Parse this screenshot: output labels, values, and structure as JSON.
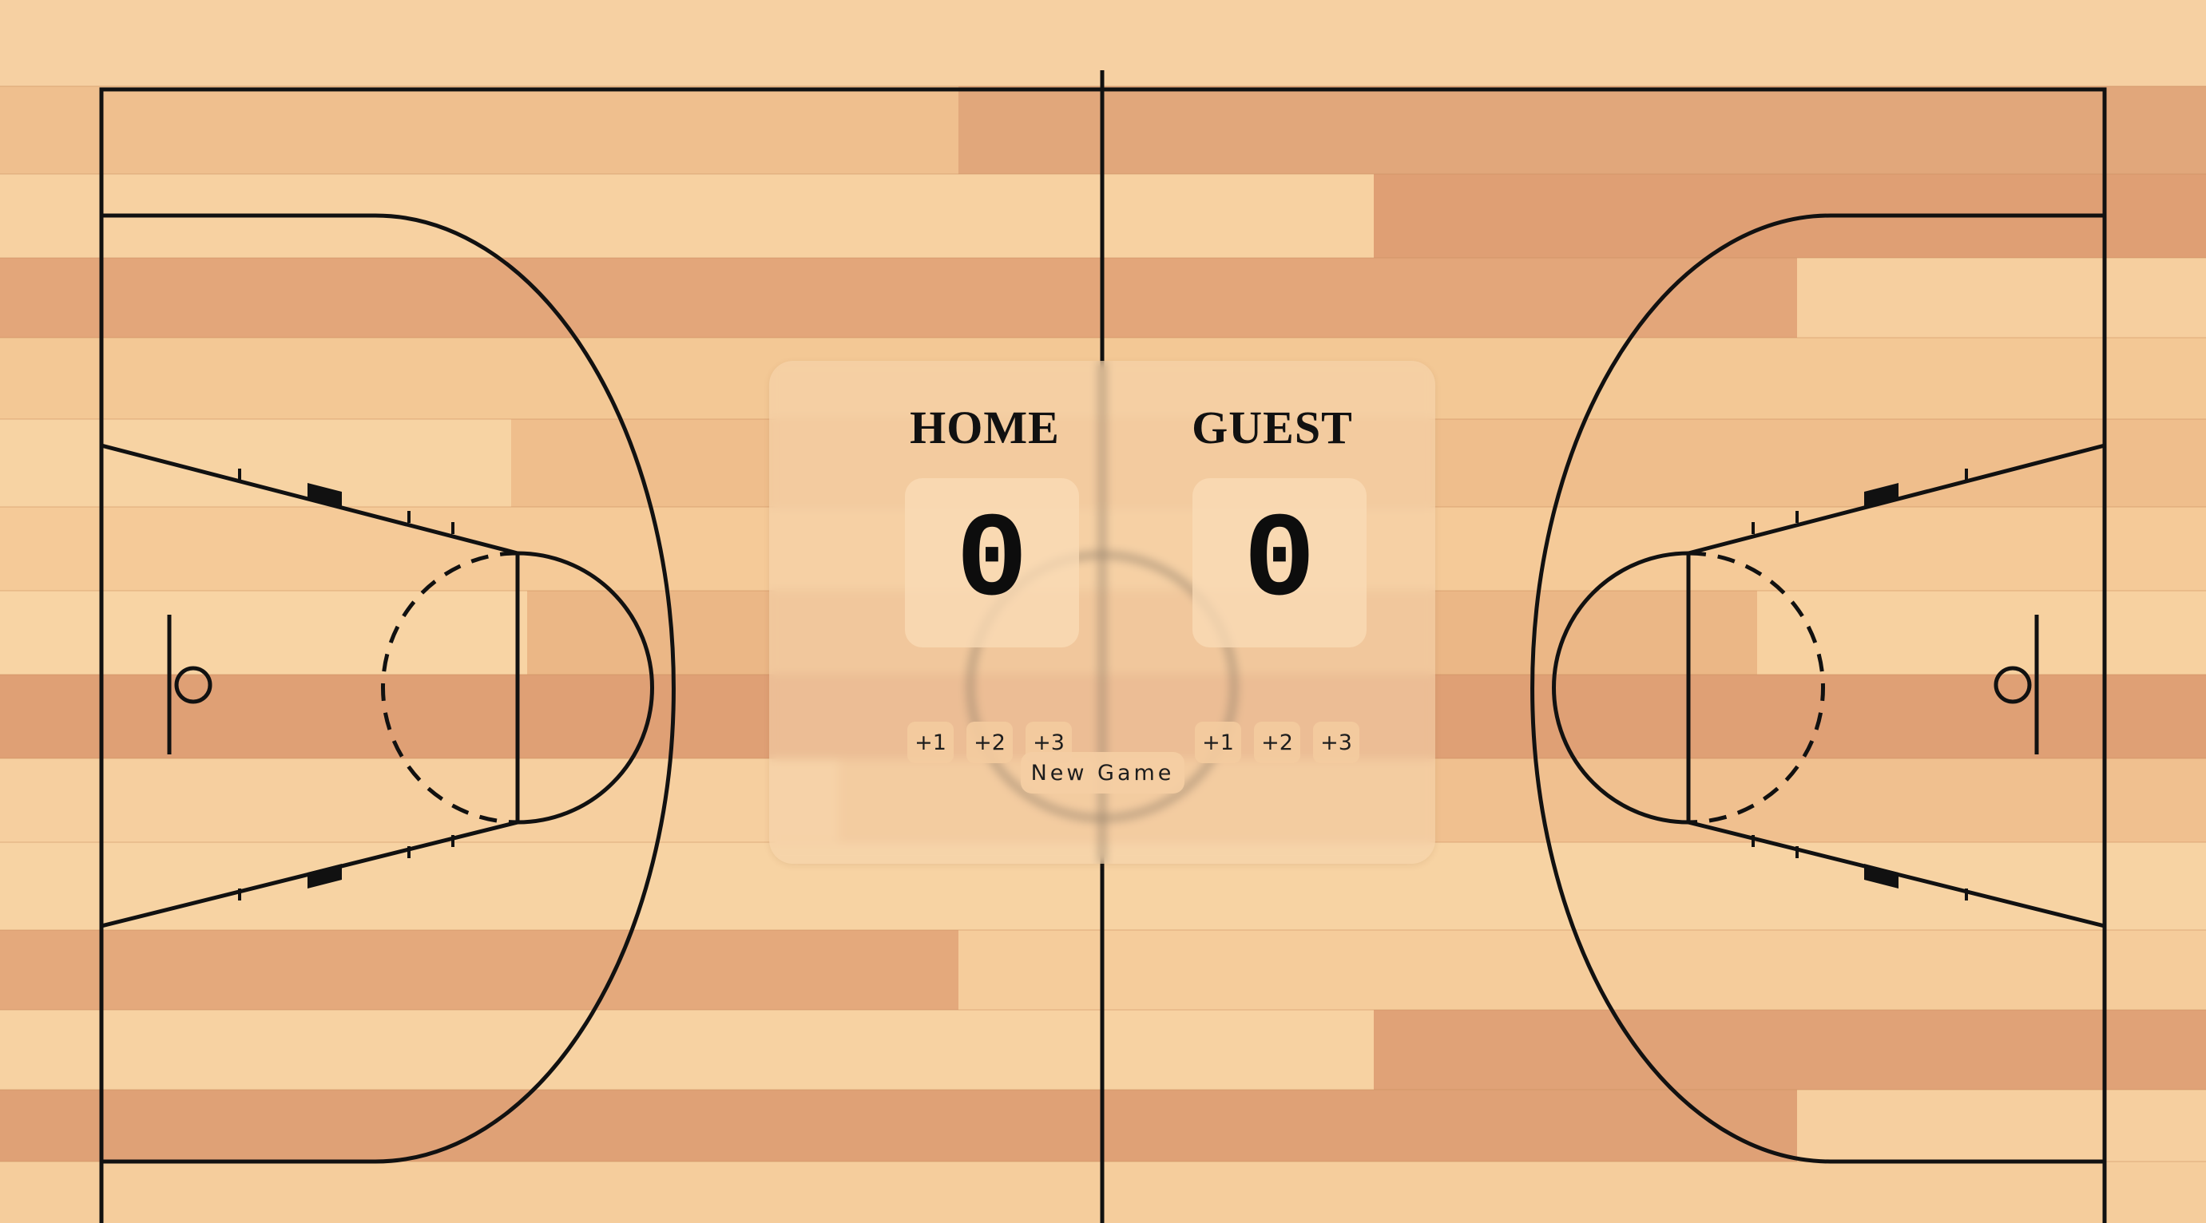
{
  "scoreboard": {
    "home": {
      "name": "HOME",
      "score": "0",
      "buttons": [
        "+1",
        "+2",
        "+3"
      ]
    },
    "guest": {
      "name": "GUEST",
      "score": "0",
      "buttons": [
        "+1",
        "+2",
        "+3"
      ]
    },
    "new_game_label": "New Game"
  },
  "colors": {
    "wood_light": "#f7d3a3",
    "wood_dark": "#dca276",
    "court_line": "#111111"
  }
}
